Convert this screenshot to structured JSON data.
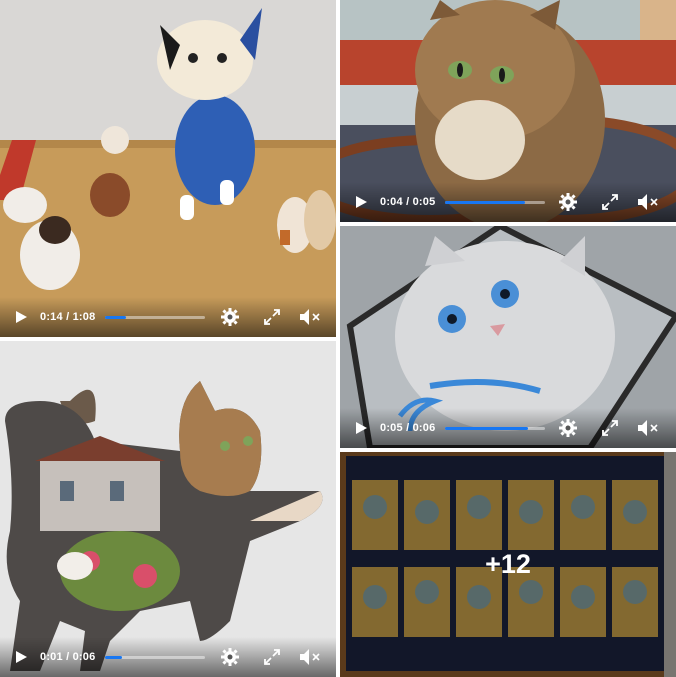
{
  "gallery": {
    "tiles": [
      {
        "kind": "video",
        "description": "porcelain-cat-figurines",
        "time": "0:14 / 1:08",
        "progress": 0.21
      },
      {
        "kind": "video",
        "description": "tabby-cat-puzzle",
        "time": "0:04 / 0:05",
        "progress": 0.8
      },
      {
        "kind": "video",
        "description": "blue-eyed-kitten-puzzle",
        "time": "0:05 / 0:06",
        "progress": 0.83
      },
      {
        "kind": "video",
        "description": "cat-silhouette-puzzle",
        "time": "0:01 / 0:06",
        "progress": 0.17
      },
      {
        "kind": "image",
        "description": "zodiac-puzzle",
        "more_count": "+12"
      }
    ]
  },
  "colors": {
    "progress": "#1877f2",
    "controls_text": "#ffffff"
  },
  "icons": [
    "play-icon",
    "settings-gear-icon",
    "fullscreen-icon",
    "volume-muted-icon"
  ]
}
